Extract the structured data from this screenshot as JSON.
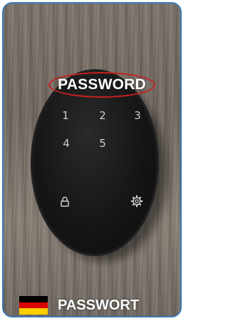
{
  "label_top": "PASSWORD",
  "label_bottom": "PASSWORT",
  "keys": [
    "1",
    "2",
    "3",
    "4",
    "5"
  ],
  "icons": [
    "lock-icon",
    "gear-icon"
  ],
  "flag": {
    "colors": [
      "#000000",
      "#dd0000",
      "#ffce00"
    ]
  },
  "colors": {
    "frame_border": "#3a78b5",
    "highlight_ellipse": "#c8201e"
  }
}
